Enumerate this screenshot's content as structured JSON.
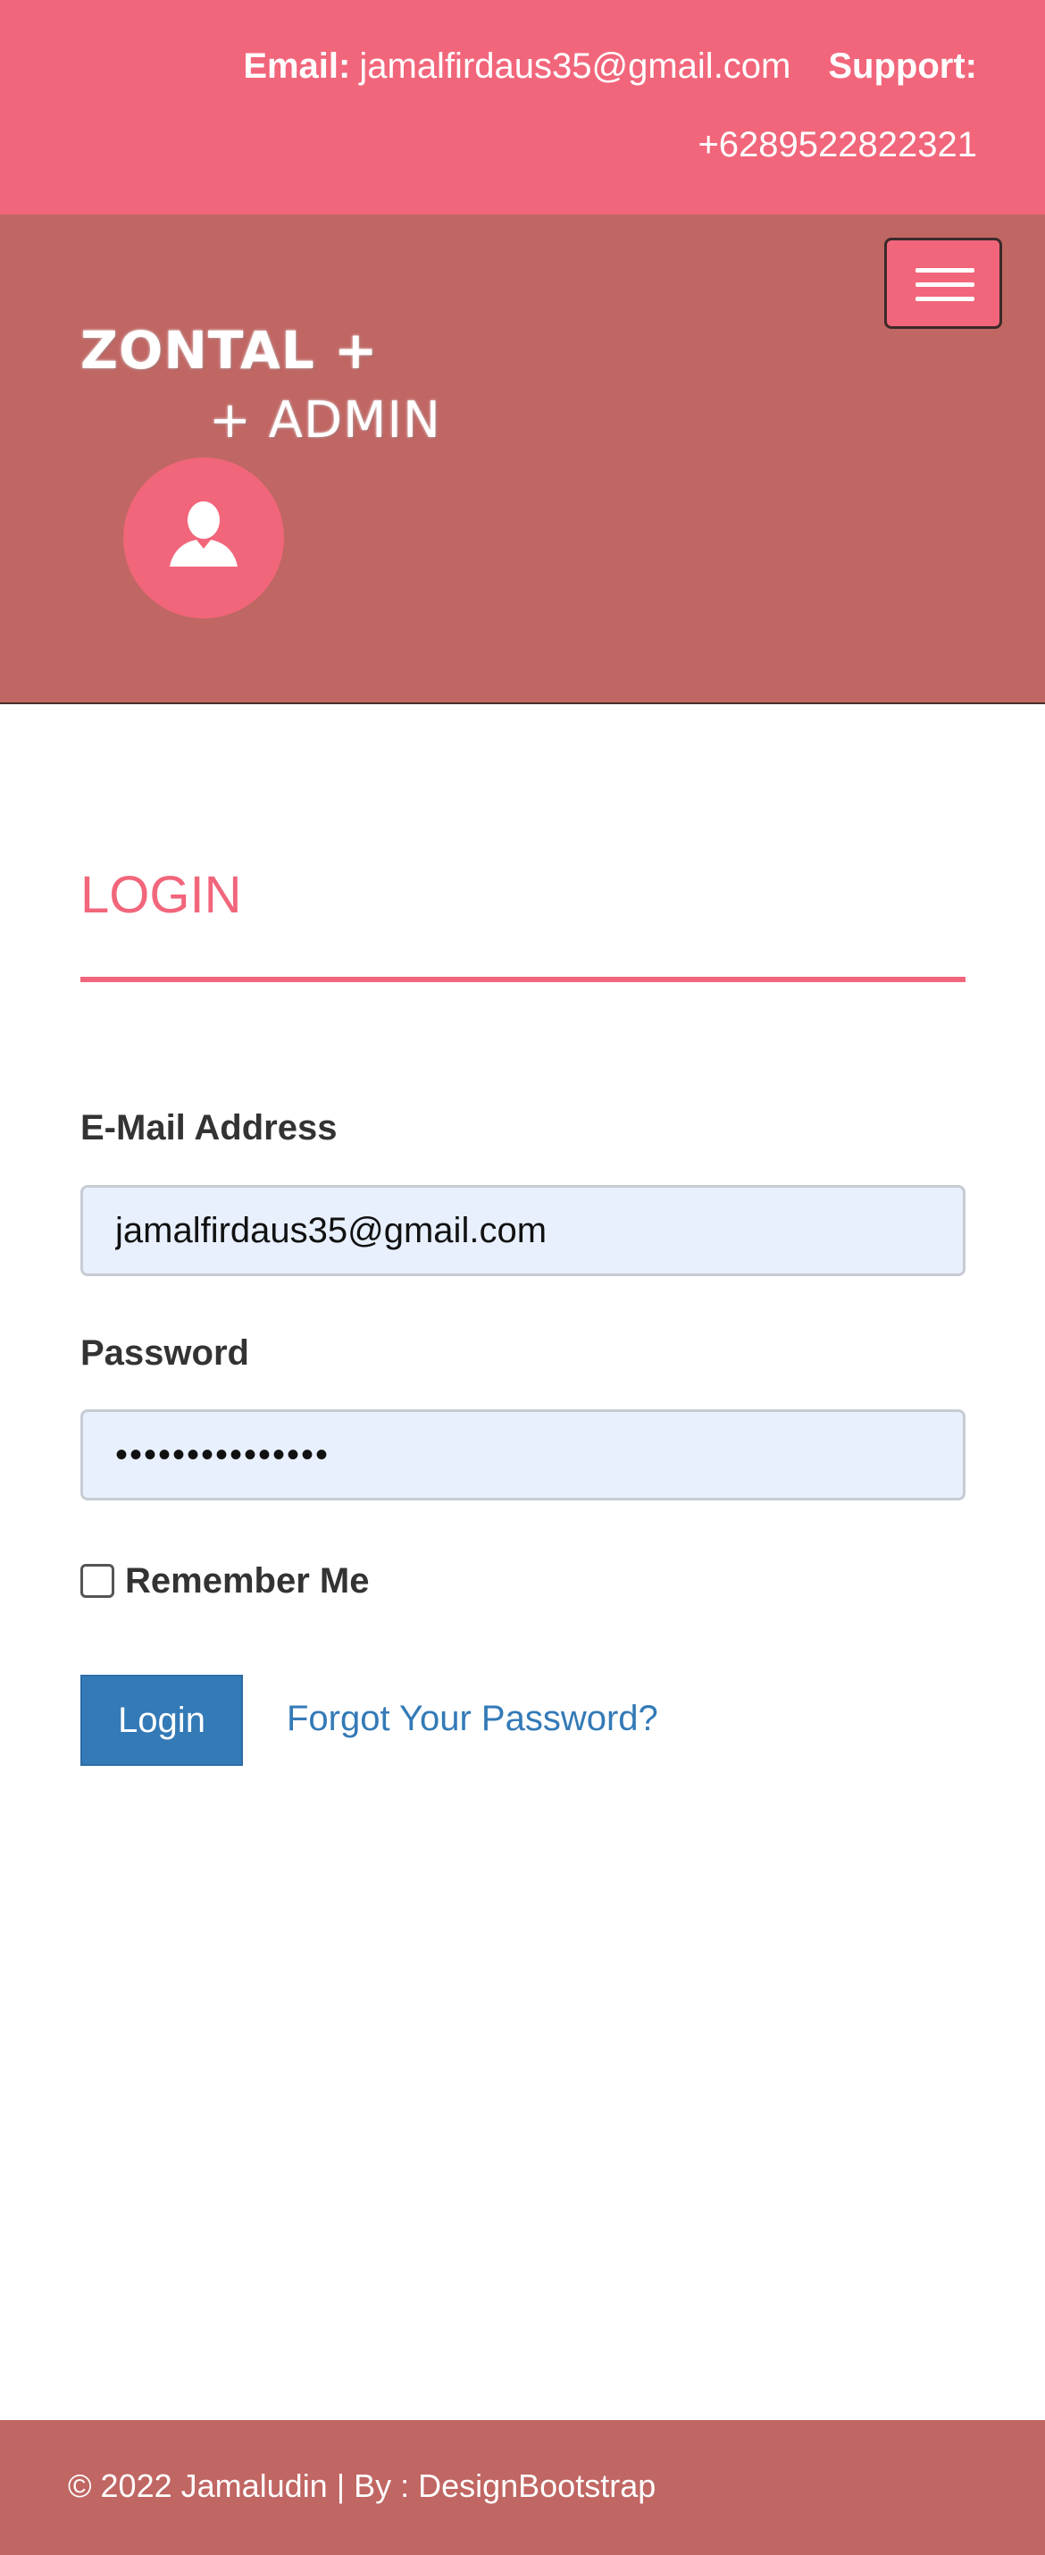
{
  "topbar": {
    "email_label": "Email:",
    "email_value": "jamalfirdaus35@gmail.com",
    "support_label": "Support:",
    "support_value": "+6289522822321"
  },
  "header": {
    "logo_line1": "ZONTAL +",
    "logo_line2": "+ ADMIN",
    "menu_icon": "hamburger-menu-icon",
    "avatar_icon": "user-icon"
  },
  "login": {
    "title": "LOGIN",
    "email_label": "E-Mail Address",
    "email_value": "jamalfirdaus35@gmail.com",
    "password_label": "Password",
    "password_value": "•••••••••••••••",
    "remember_label": "Remember Me",
    "remember_checked": false,
    "login_button": "Login",
    "forgot_link": "Forgot Your Password?"
  },
  "footer": {
    "text": "© 2022 Jamaludin | By : DesignBootstrap"
  },
  "colors": {
    "accent": "#f1667b",
    "header_bg": "#c06663",
    "primary_button": "#337ab7",
    "input_bg": "#e8f0fe"
  }
}
